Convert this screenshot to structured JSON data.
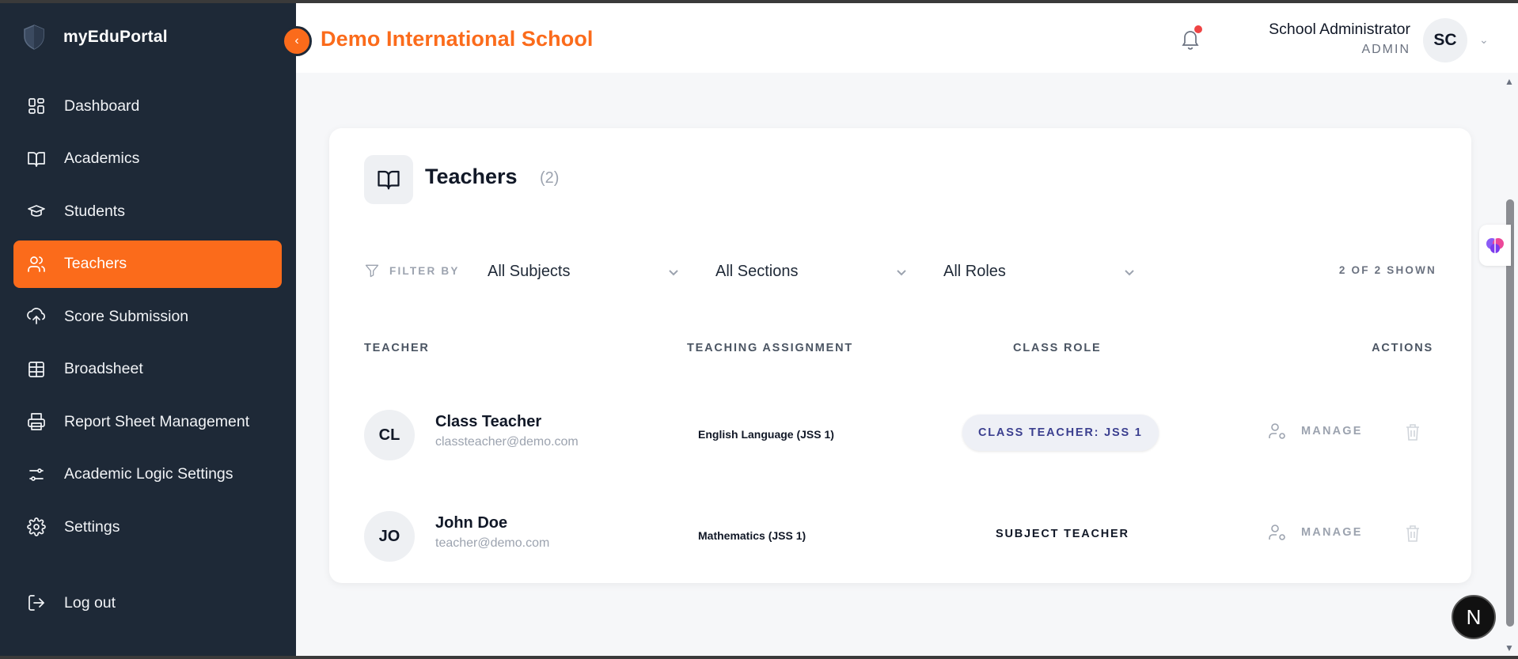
{
  "brand": {
    "name": "myEduPortal"
  },
  "sidebar": {
    "items": [
      {
        "label": "Dashboard",
        "icon": "grid-icon",
        "active": false
      },
      {
        "label": "Academics",
        "icon": "book-open-icon",
        "active": false
      },
      {
        "label": "Students",
        "icon": "graduation-cap-icon",
        "active": false
      },
      {
        "label": "Teachers",
        "icon": "users-icon",
        "active": true
      },
      {
        "label": "Score Submission",
        "icon": "cloud-upload-icon",
        "active": false
      },
      {
        "label": "Broadsheet",
        "icon": "table-icon",
        "active": false
      },
      {
        "label": "Report Sheet Management",
        "icon": "printer-icon",
        "active": false
      },
      {
        "label": "Academic Logic Settings",
        "icon": "sliders-icon",
        "active": false
      },
      {
        "label": "Settings",
        "icon": "gear-icon",
        "active": false
      }
    ],
    "logout_label": "Log out"
  },
  "header": {
    "collapse_glyph": "‹",
    "school_name": "Demo International School",
    "user_name": "School Administrator",
    "user_role": "ADMIN",
    "avatar_initials": "SC"
  },
  "page": {
    "title": "Teachers",
    "count": "(2)",
    "filter_label": "FILTER BY",
    "filters": {
      "subjects": "All Subjects",
      "sections": "All Sections",
      "roles": "All Roles"
    },
    "shown_text": "2 OF 2 SHOWN",
    "columns": {
      "teacher": "TEACHER",
      "assignment": "TEACHING ASSIGNMENT",
      "role": "CLASS ROLE",
      "actions": "ACTIONS"
    },
    "rows": [
      {
        "initials": "CL",
        "name": "Class Teacher",
        "email": "classteacher@demo.com",
        "assignment": "English Language (JSS 1)",
        "role": "CLASS TEACHER: JSS 1",
        "manage_label": "MANAGE"
      },
      {
        "initials": "JO",
        "name": "John Doe",
        "email": "teacher@demo.com",
        "assignment": "Mathematics (JSS 1)",
        "role": "SUBJECT TEACHER",
        "manage_label": "MANAGE"
      }
    ]
  },
  "floating": {
    "n_button": "N"
  },
  "colors": {
    "accent": "#fb6b1b",
    "sidebar_bg": "#1e2937",
    "badge_text": "#3b3f8f"
  }
}
